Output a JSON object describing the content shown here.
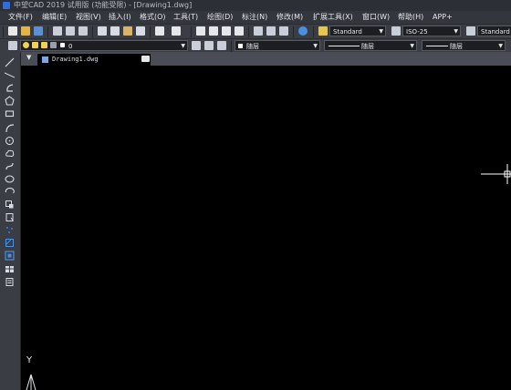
{
  "window": {
    "title": "中望CAD 2019 试用版 (功能受限) - [Drawing1.dwg]"
  },
  "menu": [
    "文件(F)",
    "编辑(E)",
    "视图(V)",
    "插入(I)",
    "格式(O)",
    "工具(T)",
    "绘图(D)",
    "标注(N)",
    "修改(M)",
    "扩展工具(X)",
    "窗口(W)",
    "帮助(H)",
    "APP+"
  ],
  "styles_toolbar": {
    "text_style": "Standard",
    "dim_style": "ISO-25",
    "table_style": "Standard"
  },
  "layers_toolbar": {
    "layer_value": "0",
    "color_value": "随层",
    "linetype_value": "随层",
    "lineweight_value": "随层"
  },
  "tabs": [
    {
      "label": "Drawing1.dwg"
    }
  ],
  "ucs": {
    "y_label": "Y"
  },
  "colors": {
    "canvas": "#000000",
    "panel": "#3a3d44",
    "accent": "#2f6fdc"
  }
}
